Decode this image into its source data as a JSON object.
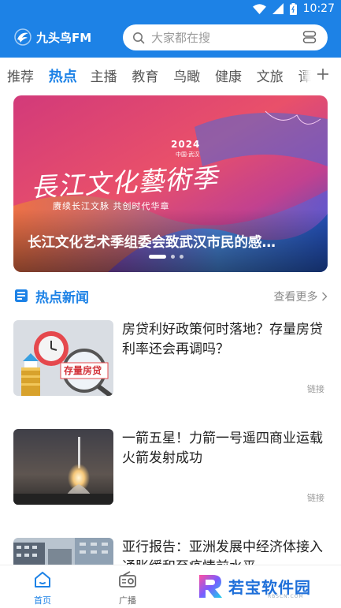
{
  "status_bar": {
    "time": "10:27",
    "icons": [
      "wifi-icon",
      "signal-icon",
      "battery-icon"
    ]
  },
  "header": {
    "app_name": "九头鸟FM",
    "search_placeholder": "大家都在搜",
    "accent_color": "#1d82e6"
  },
  "tabs": {
    "items": [
      "推荐",
      "热点",
      "主播",
      "教育",
      "鸟瞰",
      "健康",
      "文旅",
      "谭"
    ],
    "active": "热点",
    "more_icon": "plus-icon"
  },
  "banner": {
    "year": "2024",
    "top_subtext": "中国·武汉",
    "calligraphy": "長江文化藝術季",
    "slogan": "赓续长江文脉 共创时代华章",
    "caption": "长江文化艺术季组委会致武汉市民的感…",
    "dots": 3,
    "active_dot": 0
  },
  "section": {
    "title": "热点新闻",
    "more_label": "查看更多",
    "icon": "news-doc-icon"
  },
  "news": [
    {
      "title": "房贷利好政策何时落地？存量房贷利率还会再调吗？",
      "tag": "链接",
      "thumb_label": "存量房贷"
    },
    {
      "title": "一箭五星！力箭一号遥四商业运载火箭发射成功",
      "tag": "链接"
    },
    {
      "title": "亚行报告：亚洲发展中经济体接入通胀缓和至疫情前水平",
      "tag": ""
    }
  ],
  "bottom_nav": {
    "items": [
      {
        "label": "首页",
        "icon": "home-icon",
        "active": true
      },
      {
        "label": "广播",
        "icon": "radio-icon",
        "active": false
      }
    ]
  },
  "watermark": {
    "text": "若宝软件园",
    "sub": "RBSCN.COM"
  }
}
